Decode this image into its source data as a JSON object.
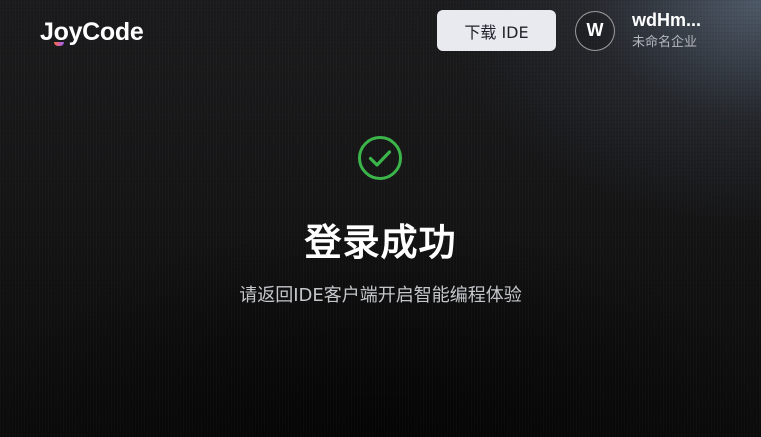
{
  "header": {
    "logo_text": "JoyCode",
    "download_label": "下载 IDE"
  },
  "user": {
    "avatar_letter": "W",
    "name": "wdHm...",
    "org": "未命名企业"
  },
  "status": {
    "icon": "check-circle-icon",
    "title": "登录成功",
    "message": "请返回IDE客户端开启智能编程体验"
  },
  "colors": {
    "success": "#3bb54a",
    "button_bg": "#e8eaf0"
  }
}
